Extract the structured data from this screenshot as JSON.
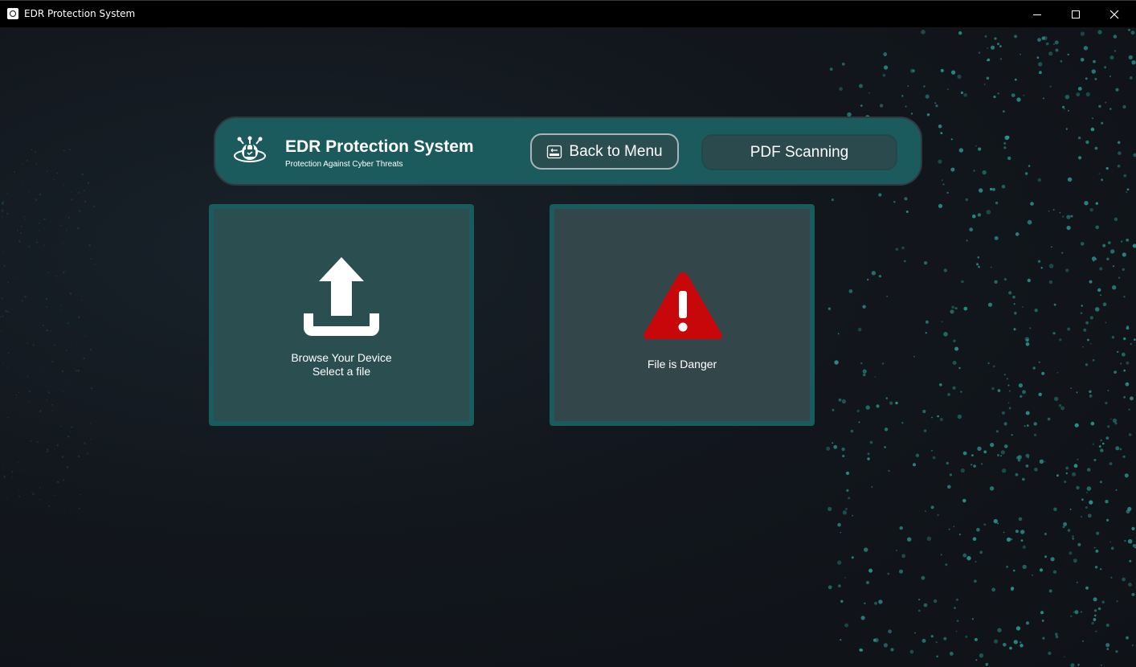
{
  "window": {
    "title": "EDR Protection System",
    "controls": {
      "minimize": "minimize-icon",
      "maximize": "maximize-icon",
      "close": "close-icon"
    }
  },
  "header": {
    "title": "EDR Protection System",
    "subtitle": "Protection Against Cyber Threats",
    "logo_icon": "shield-lock-robot-icon",
    "back_button": {
      "label": "Back to Menu",
      "icon": "back-icon"
    },
    "pdf_button": {
      "label": "PDF Scanning"
    }
  },
  "upload_card": {
    "icon": "upload-icon",
    "line1": "Browse Your Device",
    "line2": "Select a file"
  },
  "result_card": {
    "icon": "warning-triangle-icon",
    "status_text": "File is Danger"
  },
  "colors": {
    "header_bg": "#1b5a5d",
    "card_border": "#1a5c5e",
    "upload_card_bg": "#2b4f50",
    "result_card_bg": "#33474a",
    "danger": "#c8070b",
    "dots": "#2a9a94"
  }
}
